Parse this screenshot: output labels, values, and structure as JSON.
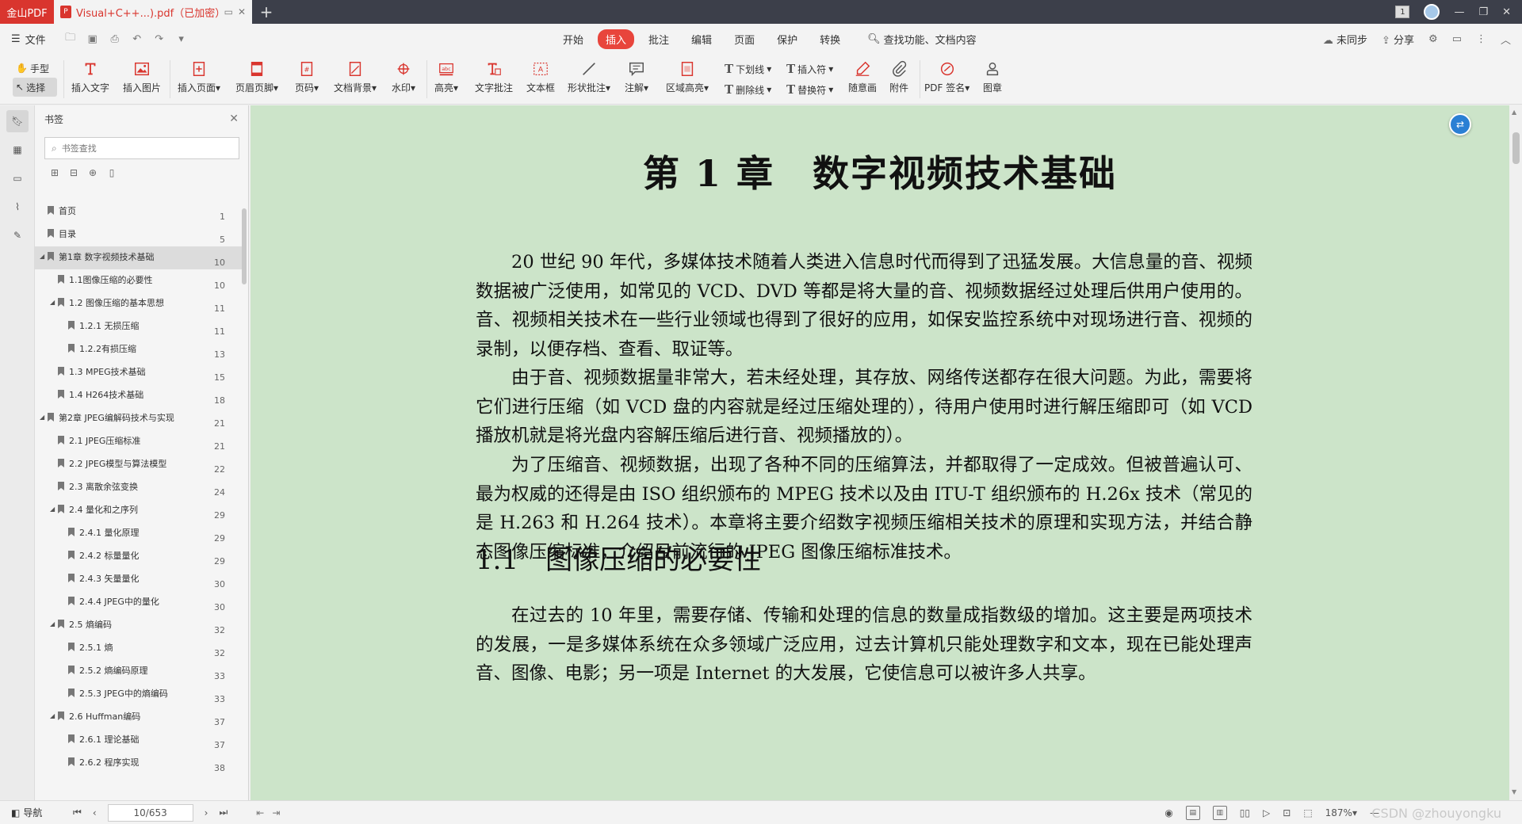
{
  "titlebar": {
    "app_name": "金山PDF",
    "doc_tab_title": "Visual+C++...).pdf（已加密）",
    "new_tab": "+",
    "badge": "1",
    "minimize": "—",
    "restore": "❐",
    "close": "✕"
  },
  "menu": {
    "file": "文件",
    "tabs": [
      "开始",
      "插入",
      "批注",
      "编辑",
      "页面",
      "保护",
      "转换"
    ],
    "active_tab": "插入",
    "search": "查找功能、文档内容",
    "sync": "未同步",
    "share": "分享"
  },
  "ribbon": {
    "hand": "手型",
    "select": "选择",
    "insert_text": "插入文字",
    "insert_image": "插入图片",
    "insert_page": "插入页面",
    "header_footer": "页眉页脚",
    "page_number": "页码",
    "doc_background": "文档背景",
    "watermark": "水印",
    "highlight": "高亮",
    "text_comment": "文字批注",
    "textbox": "文本框",
    "shape_comment": "形状批注",
    "annotation": "注解",
    "area_highlight": "区域高亮",
    "underline": "下划线",
    "strikethrough": "删除线",
    "caret": "插入符",
    "replace": "替换符",
    "freehand": "随意画",
    "attachment": "附件",
    "pdf_sign": "PDF 签名",
    "stamp": "图章",
    "dropdown": "▾"
  },
  "bookmarks": {
    "title": "书签",
    "search_placeholder": "书签查找",
    "items": [
      {
        "label": "首页",
        "page": "1",
        "level": 0,
        "arrow": ""
      },
      {
        "label": "目录",
        "page": "5",
        "level": 0,
        "arrow": ""
      },
      {
        "label": "第1章 数字视频技术基础",
        "page": "10",
        "level": 0,
        "arrow": "◢",
        "selected": true
      },
      {
        "label": "1.1图像压缩的必要性",
        "page": "10",
        "level": 1,
        "arrow": ""
      },
      {
        "label": "1.2 图像压缩的基本思想",
        "page": "11",
        "level": 1,
        "arrow": "◢"
      },
      {
        "label": "1.2.1 无损压缩",
        "page": "11",
        "level": 2,
        "arrow": ""
      },
      {
        "label": "1.2.2有损压缩",
        "page": "13",
        "level": 2,
        "arrow": ""
      },
      {
        "label": "1.3 MPEG技术基础",
        "page": "15",
        "level": 1,
        "arrow": ""
      },
      {
        "label": "1.4 H264技术基础",
        "page": "18",
        "level": 1,
        "arrow": ""
      },
      {
        "label": "第2章 JPEG编解码技术与实现",
        "page": "21",
        "level": 0,
        "arrow": "◢"
      },
      {
        "label": "2.1 JPEG压缩标准",
        "page": "21",
        "level": 1,
        "arrow": ""
      },
      {
        "label": "2.2 JPEG模型与算法模型",
        "page": "22",
        "level": 1,
        "arrow": ""
      },
      {
        "label": "2.3 离散余弦变换",
        "page": "24",
        "level": 1,
        "arrow": ""
      },
      {
        "label": "2.4 量化和之序列",
        "page": "29",
        "level": 1,
        "arrow": "◢"
      },
      {
        "label": "2.4.1 量化原理",
        "page": "29",
        "level": 2,
        "arrow": ""
      },
      {
        "label": "2.4.2 标量量化",
        "page": "29",
        "level": 2,
        "arrow": ""
      },
      {
        "label": "2.4.3 矢量量化",
        "page": "30",
        "level": 2,
        "arrow": ""
      },
      {
        "label": "2.4.4 JPEG中的量化",
        "page": "30",
        "level": 2,
        "arrow": ""
      },
      {
        "label": "2.5 熵编码",
        "page": "32",
        "level": 1,
        "arrow": "◢"
      },
      {
        "label": "2.5.1 熵",
        "page": "32",
        "level": 2,
        "arrow": ""
      },
      {
        "label": "2.5.2 熵编码原理",
        "page": "33",
        "level": 2,
        "arrow": ""
      },
      {
        "label": "2.5.3 JPEG中的熵编码",
        "page": "33",
        "level": 2,
        "arrow": ""
      },
      {
        "label": "2.6 Huffman编码",
        "page": "37",
        "level": 1,
        "arrow": "◢"
      },
      {
        "label": "2.6.1 理论基础",
        "page": "37",
        "level": 2,
        "arrow": ""
      },
      {
        "label": "2.6.2 程序实现",
        "page": "38",
        "level": 2,
        "arrow": ""
      }
    ]
  },
  "document": {
    "chapter_title": "第 1 章　数字视频技术基础",
    "paragraphs": [
      "20 世纪 90 年代，多媒体技术随着人类进入信息时代而得到了迅猛发展。大信息量的音、视频数据被广泛使用，如常见的 VCD、DVD 等都是将大量的音、视频数据经过处理后供用户使用的。音、视频相关技术在一些行业领域也得到了很好的应用，如保安监控系统中对现场进行音、视频的录制，以便存档、查看、取证等。",
      "由于音、视频数据量非常大，若未经处理，其存放、网络传送都存在很大问题。为此，需要将它们进行压缩（如 VCD 盘的内容就是经过压缩处理的），待用户使用时进行解压缩即可（如 VCD 播放机就是将光盘内容解压缩后进行音、视频播放的）。",
      "为了压缩音、视频数据，出现了各种不同的压缩算法，并都取得了一定成效。但被普遍认可、最为权威的还得是由 ISO 组织颁布的 MPEG 技术以及由 ITU-T 组织颁布的 H.26x 技术（常见的是 H.263 和 H.264 技术）。本章将主要介绍数字视频压缩相关技术的原理和实现方法，并结合静态图像压缩标准，介绍目前流行的 JPEG 图像压缩标准技术。"
    ],
    "section_title": "1.1　图像压缩的必要性",
    "section_paragraph": "在过去的 10 年里，需要存储、传输和处理的信息的数量成指数级的增加。这主要是两项技术的发展，一是多媒体系统在众多领域广泛应用，过去计算机只能处理数字和文本，现在已能处理声音、图像、电影；另一项是 Internet 的大发展，它使信息可以被许多人共享。"
  },
  "statusbar": {
    "nav": "导航",
    "page_value": "10/653",
    "zoom": "187%",
    "zoom_dropdown": "▾",
    "watermark_text": "CSDN @zhouyongku"
  },
  "colors": {
    "accent": "#e8453c",
    "page_bg": "#cce4c9",
    "titlebar_bg": "#3c3f4a"
  }
}
